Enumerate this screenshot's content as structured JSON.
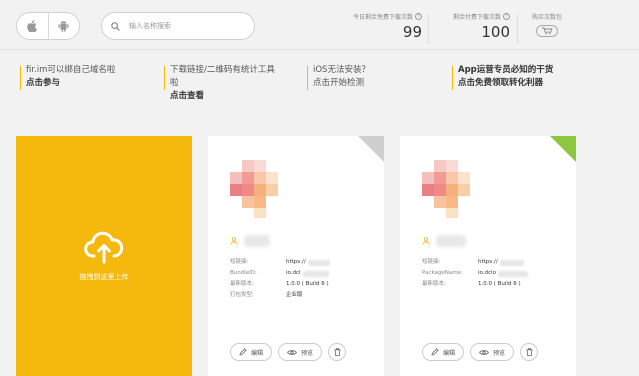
{
  "search": {
    "placeholder": "输入名称搜索"
  },
  "stats": [
    {
      "label": "今日剩余免费下载次数",
      "value": "99"
    },
    {
      "label": "剩余付费下载次数",
      "value": "100"
    }
  ],
  "buy": {
    "label": "购买次数包"
  },
  "promos": [
    {
      "line1": "fir.im可以绑自己域名啦",
      "line2": "点击参与"
    },
    {
      "line1": "下载链接/二维码有统计工具啦",
      "line2": "点击查看"
    },
    {
      "line1": "iOS无法安装？",
      "line2": "点击开始检测"
    },
    {
      "line1": "App运营专员必知的干货",
      "line2": "点击免费领取转化利器"
    }
  ],
  "upload": {
    "label": "拖拽到这里上传"
  },
  "apps": [
    {
      "platform": "ios",
      "rows": [
        {
          "key": "短链接:",
          "value": "https://"
        },
        {
          "key": "BundleID:",
          "value": "io.dcl"
        },
        {
          "key": "最新版本:",
          "value": "1.0.0 ( Build 6 )"
        },
        {
          "key": "打包类型:",
          "value": "企业版"
        }
      ]
    },
    {
      "platform": "android",
      "rows": [
        {
          "key": "短链接:",
          "value": "https://"
        },
        {
          "key": "PackageName:",
          "value": "io.dclo"
        },
        {
          "key": "最新版本:",
          "value": "1.0.0 ( Build 6 )"
        }
      ]
    }
  ],
  "actions": {
    "edit": "编辑",
    "preview": "预览"
  },
  "colors": {
    "accent": "#f5b80c",
    "android": "#8dc63f",
    "ios_corner": "#cfcfcf"
  }
}
